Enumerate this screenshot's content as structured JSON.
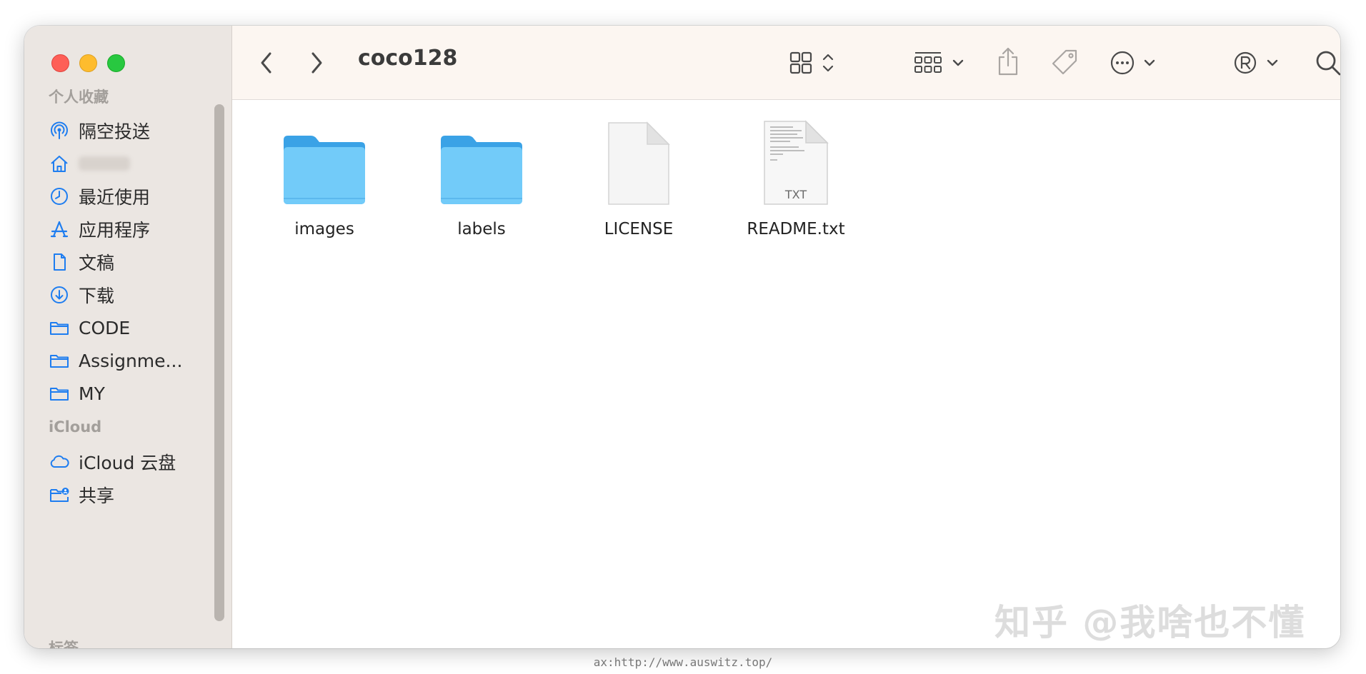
{
  "sidebar": {
    "favorites_header": "个人收藏",
    "items": [
      {
        "label": "隔空投送",
        "icon": "airdrop-icon"
      },
      {
        "label": "",
        "icon": "home-icon"
      },
      {
        "label": "最近使用",
        "icon": "clock-icon"
      },
      {
        "label": "应用程序",
        "icon": "applications-icon"
      },
      {
        "label": "文稿",
        "icon": "document-icon"
      },
      {
        "label": "下载",
        "icon": "download-icon"
      },
      {
        "label": "CODE",
        "icon": "folder-icon"
      },
      {
        "label": "Assignme...",
        "icon": "folder-icon"
      },
      {
        "label": "MY",
        "icon": "folder-icon"
      }
    ],
    "icloud_header": "iCloud",
    "icloud_items": [
      {
        "label": "iCloud 云盘",
        "icon": "cloud-icon"
      },
      {
        "label": "共享",
        "icon": "shared-folder-icon"
      }
    ],
    "tags_header": "标签"
  },
  "toolbar": {
    "title": "coco128",
    "buttons": [
      "back-icon",
      "forward-icon",
      "grid-view-icon",
      "group-icon",
      "share-icon",
      "tag-icon",
      "more-icon",
      "registered-icon",
      "search-icon"
    ]
  },
  "files": [
    {
      "name": "images",
      "kind": "folder"
    },
    {
      "name": "labels",
      "kind": "folder"
    },
    {
      "name": "LICENSE",
      "kind": "document"
    },
    {
      "name": "README.txt",
      "kind": "text",
      "badge": "TXT"
    }
  ],
  "watermark": "知乎 @我啥也不懂",
  "caption": "ax:http://www.auswitz.top/",
  "colors": {
    "accent": "#1e7df0",
    "folder": "#6dc7f7",
    "sidebar_bg": "#ebe6e2",
    "toolbar_bg": "#fcf6f1"
  }
}
